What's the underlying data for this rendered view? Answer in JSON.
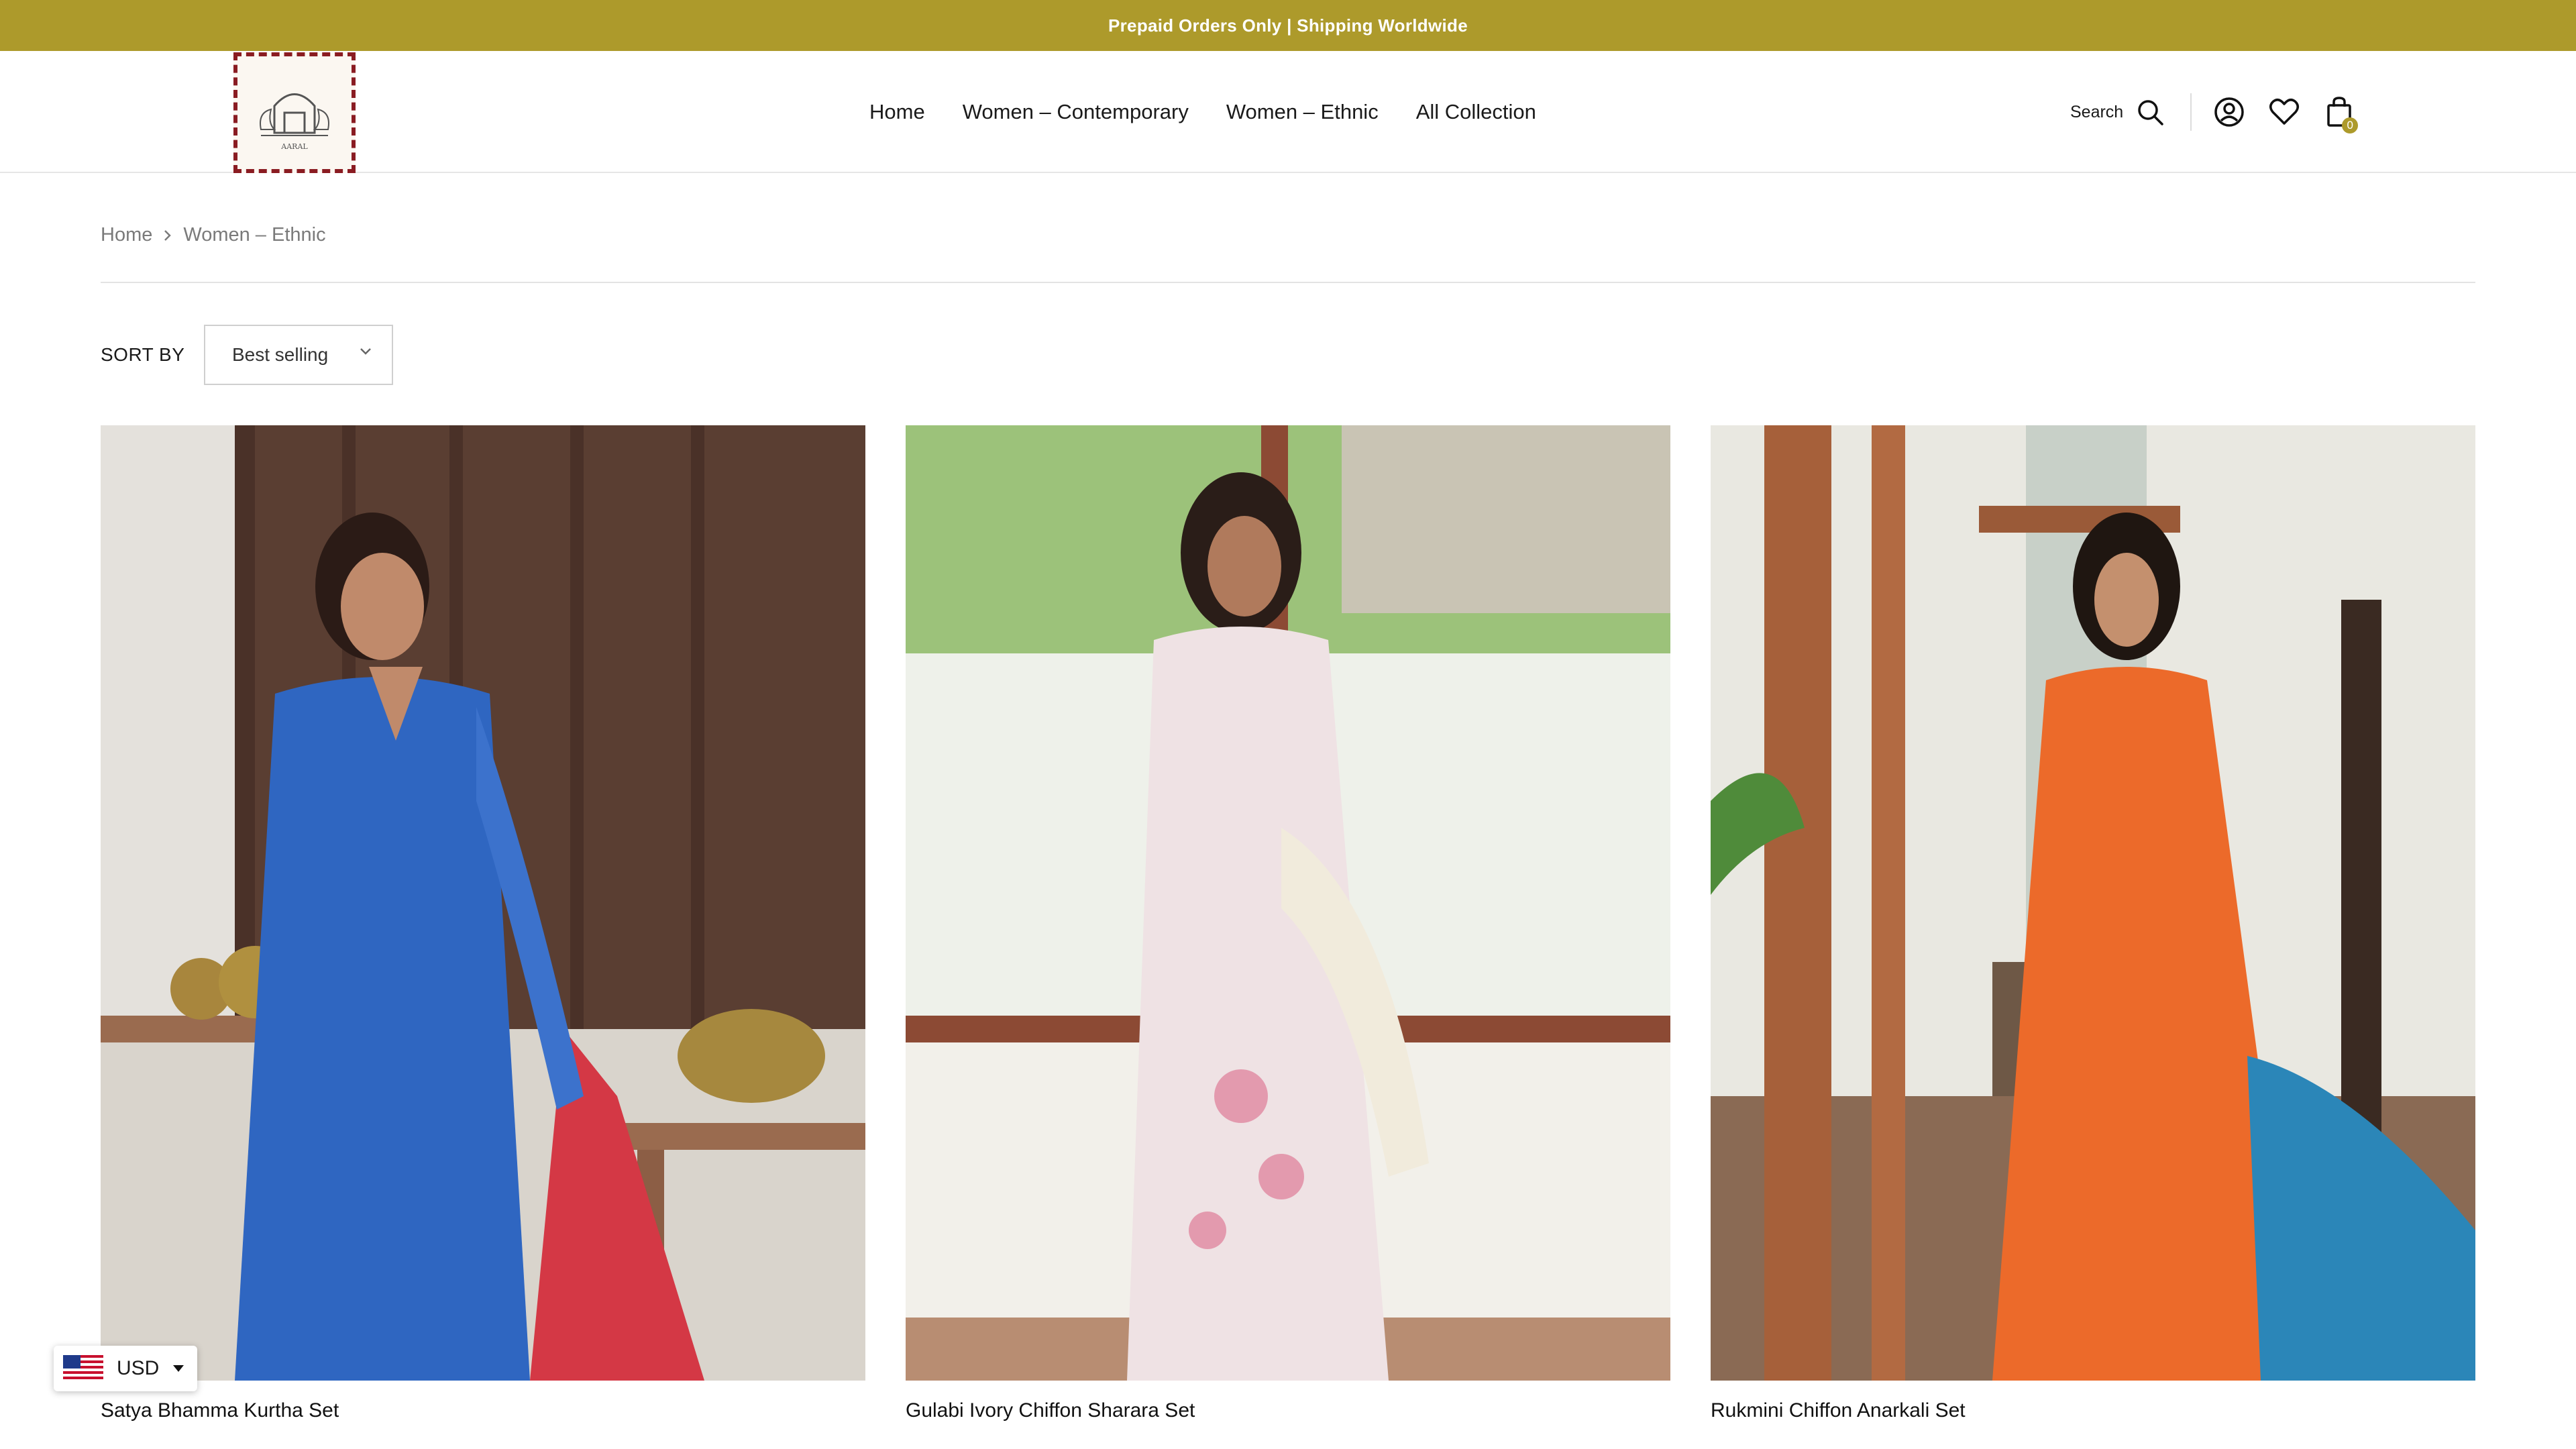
{
  "announcement": "Prepaid Orders Only | Shipping Worldwide",
  "logo": {
    "text": "AARAL"
  },
  "nav": [
    "Home",
    "Women – Contemporary",
    "Women – Ethnic",
    "All Collection"
  ],
  "header_actions": {
    "search_label": "Search",
    "cart_count": "0"
  },
  "breadcrumb": [
    "Home",
    "Women – Ethnic"
  ],
  "sort": {
    "label": "SORT BY",
    "selected": "Best selling"
  },
  "products": [
    {
      "name": "Satya Bhamma Kurtha Set"
    },
    {
      "name": "Gulabi Ivory Chiffon Sharara Set"
    },
    {
      "name": "Rukmini Chiffon Anarkali Set"
    }
  ],
  "currency": {
    "code": "USD"
  },
  "colors": {
    "accent": "#ad9a2b",
    "logo_border": "#8a1c22"
  }
}
